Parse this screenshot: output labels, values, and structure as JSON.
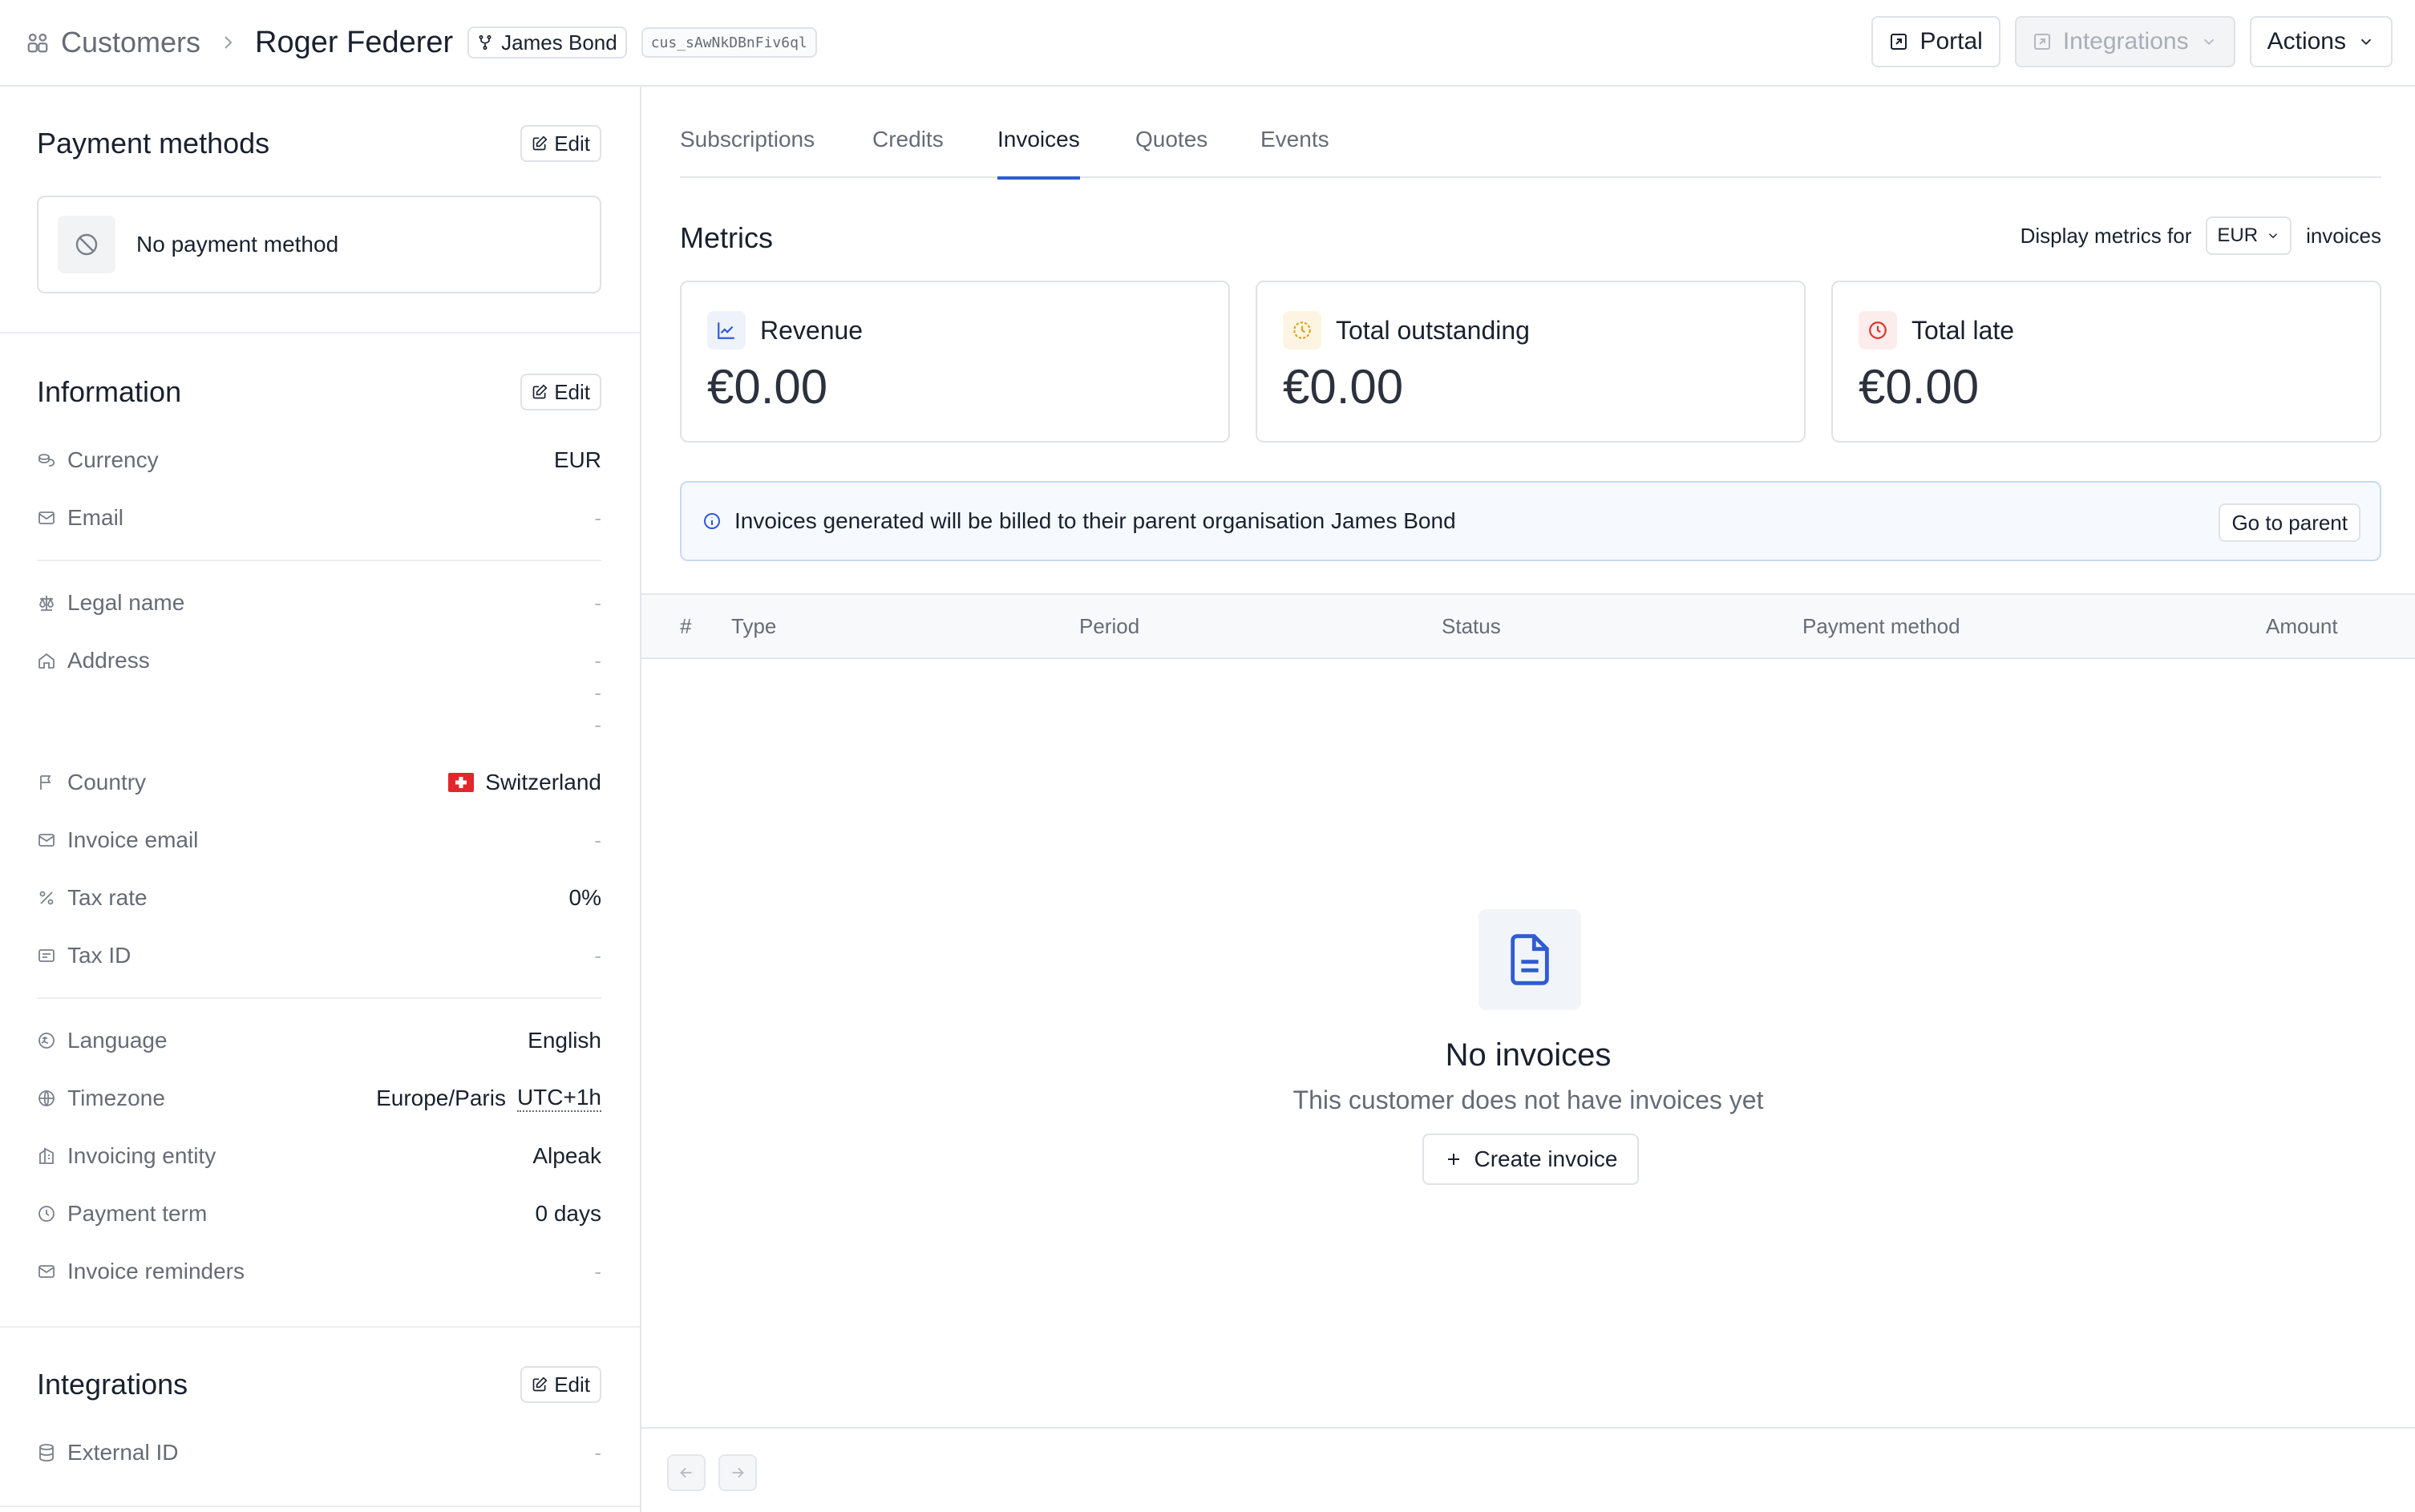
{
  "breadcrumb": {
    "root": "Customers",
    "current": "Roger Federer",
    "parent_badge": "James Bond",
    "customer_id": "cus_sAwNkDBnFiv6ql"
  },
  "top_actions": {
    "portal": "Portal",
    "integrations": "Integrations",
    "actions": "Actions"
  },
  "sidebar": {
    "payment_methods": {
      "title": "Payment methods",
      "edit": "Edit",
      "empty": "No payment method"
    },
    "information": {
      "title": "Information",
      "edit": "Edit",
      "currency": {
        "label": "Currency",
        "value": "EUR"
      },
      "email": {
        "label": "Email",
        "value": "-"
      },
      "legal_name": {
        "label": "Legal name",
        "value": "-"
      },
      "address": {
        "label": "Address",
        "lines": [
          "-",
          "-",
          "-"
        ]
      },
      "country": {
        "label": "Country",
        "value": "Switzerland"
      },
      "invoice_email": {
        "label": "Invoice email",
        "value": "-"
      },
      "tax_rate": {
        "label": "Tax rate",
        "value": "0%"
      },
      "tax_id": {
        "label": "Tax ID",
        "value": "-"
      },
      "language": {
        "label": "Language",
        "value": "English"
      },
      "timezone": {
        "label": "Timezone",
        "value": "Europe/Paris",
        "offset": "UTC+1h"
      },
      "invoicing_entity": {
        "label": "Invoicing entity",
        "value": "Alpeak"
      },
      "payment_term": {
        "label": "Payment term",
        "value": "0 days"
      },
      "invoice_reminders": {
        "label": "Invoice reminders",
        "value": "-"
      }
    },
    "integrations": {
      "title": "Integrations",
      "edit": "Edit",
      "external_id": {
        "label": "External ID",
        "value": "-"
      }
    }
  },
  "tabs": {
    "subscriptions": "Subscriptions",
    "credits": "Credits",
    "invoices": "Invoices",
    "quotes": "Quotes",
    "events": "Events",
    "active": "Invoices"
  },
  "metrics": {
    "title": "Metrics",
    "filter_prefix": "Display metrics for",
    "currency": "EUR",
    "filter_suffix": "invoices",
    "revenue": {
      "label": "Revenue",
      "value": "€0.00"
    },
    "outstanding": {
      "label": "Total outstanding",
      "value": "€0.00"
    },
    "late": {
      "label": "Total late",
      "value": "€0.00"
    }
  },
  "banner": {
    "text": "Invoices generated will be billed to their parent organisation James Bond",
    "button": "Go to parent"
  },
  "table": {
    "columns": [
      "#",
      "Type",
      "Period",
      "Status",
      "Payment method",
      "Amount"
    ]
  },
  "empty_state": {
    "title": "No invoices",
    "subtitle": "This customer does not have invoices yet",
    "button": "Create invoice"
  },
  "colors": {
    "accent": "#2f5bd3",
    "outstanding": "#e0a21c",
    "late": "#d8342b",
    "flag_red": "#e3262b"
  }
}
